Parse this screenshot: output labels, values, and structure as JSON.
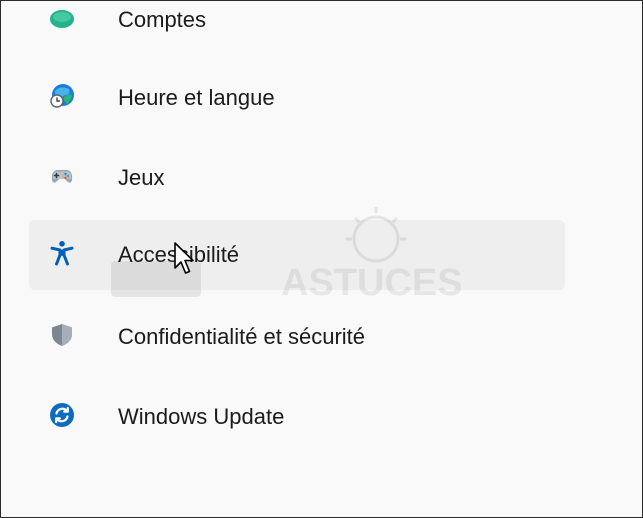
{
  "nav": {
    "items": [
      {
        "label": "Comptes",
        "icon": "account-icon"
      },
      {
        "label": "Heure et langue",
        "icon": "globe-clock-icon"
      },
      {
        "label": "Jeux",
        "icon": "gamepad-icon"
      },
      {
        "label": "Accessibilité",
        "icon": "accessibility-icon",
        "selected": true
      },
      {
        "label": "Confidentialité et sécurité",
        "icon": "shield-icon"
      },
      {
        "label": "Windows Update",
        "icon": "windows-update-icon"
      }
    ]
  },
  "watermark": {
    "text": "ASTUCES"
  },
  "colors": {
    "accent": "#005fb8",
    "selected_bg": "#eeeeee",
    "text": "#1b1b1b",
    "comptes_icon": "#23b28a",
    "shield": "#7d8792"
  }
}
